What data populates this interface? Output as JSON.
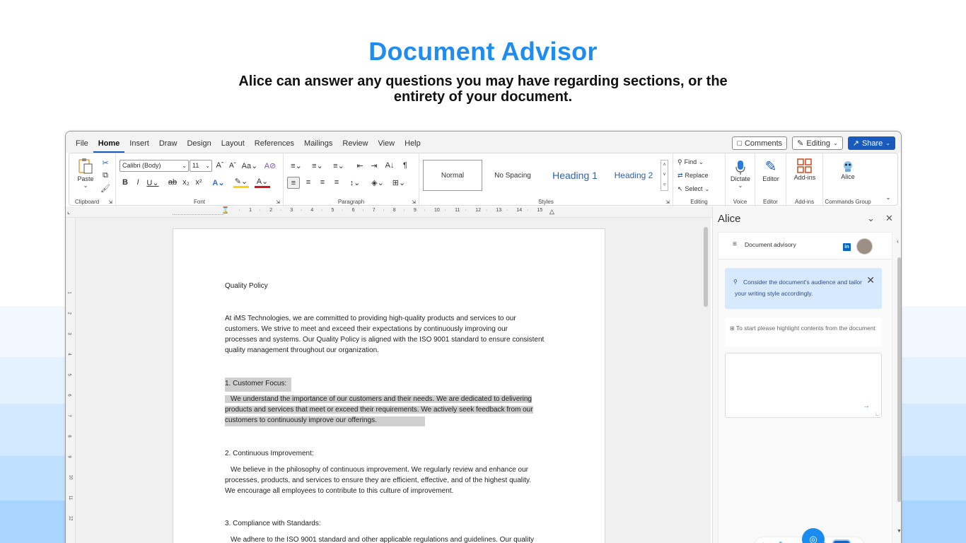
{
  "hero": {
    "title": "Document Advisor",
    "subtitle_line1": "Alice can answer any questions you may have regarding sections, or the",
    "subtitle_line2": "entirety of your document."
  },
  "menubar": {
    "items": [
      "File",
      "Home",
      "Insert",
      "Draw",
      "Design",
      "Layout",
      "References",
      "Mailings",
      "Review",
      "View",
      "Help"
    ],
    "active": "Home",
    "comments": "Comments",
    "editing": "Editing",
    "share": "Share"
  },
  "ribbon": {
    "clipboard": {
      "paste": "Paste",
      "label": "Clipboard"
    },
    "font": {
      "family": "Calibri (Body)",
      "size": "11",
      "label": "Font"
    },
    "paragraph": {
      "label": "Paragraph"
    },
    "styles": {
      "items": [
        "Normal",
        "No Spacing",
        "Heading 1",
        "Heading 2"
      ],
      "label": "Styles"
    },
    "editing": {
      "find": "Find",
      "replace": "Replace",
      "select": "Select",
      "label": "Editing"
    },
    "voice": {
      "dictate": "Dictate",
      "label": "Voice"
    },
    "editor": {
      "editor": "Editor",
      "label": "Editor"
    },
    "addins": {
      "addins": "Add-ins",
      "label": "Add-ins"
    },
    "commands": {
      "alice": "Alice",
      "label": "Commands Group"
    }
  },
  "ruler": {
    "labels": [
      "1",
      "2",
      "3",
      "4",
      "5",
      "6",
      "7",
      "8",
      "9",
      "10",
      "11",
      "12",
      "13",
      "14",
      "15"
    ]
  },
  "vertical_ruler": {
    "labels": [
      "1",
      "2",
      "3",
      "4",
      "5",
      "6",
      "7",
      "8",
      "9",
      "10",
      "11",
      "12"
    ]
  },
  "document": {
    "title": "Quality Policy",
    "intro": [
      "At iMS Technologies, we are committed to providing high-quality products and services to our",
      "customers. We strive to meet and exceed their expectations by continuously improving our",
      "processes and systems. Our Quality Policy is aligned with the ISO 9001 standard to ensure consistent",
      "quality management throughout our organization."
    ],
    "s1_heading": "1. Customer Focus:",
    "s1_body": [
      "We understand the importance of our customers and their needs. We are dedicated to delivering",
      "products and services that meet or exceed their requirements. We actively seek feedback from our",
      "customers to continuously improve our offerings."
    ],
    "s2_heading": "2. Continuous Improvement:",
    "s2_body": [
      "We believe in the philosophy of continuous improvement. We regularly review and enhance our",
      "processes, products, and services to ensure they are efficient, effective, and of the highest quality.",
      "We encourage all employees to contribute to this culture of improvement."
    ],
    "s3_heading": "3. Compliance with Standards:",
    "s3_body": [
      "We adhere to the ISO 9001 standard and other applicable regulations and guidelines. Our quality"
    ]
  },
  "pane": {
    "title": "Alice",
    "mode": "Document advisory",
    "tip": "Consider the document's audience and tailor your writing style accordingly.",
    "info": "To start please highlight contents from the document",
    "colors": {
      "accent": "#1a8cf0",
      "tip_bg": "#d6e9ff",
      "word_blue": "#185abd"
    }
  }
}
